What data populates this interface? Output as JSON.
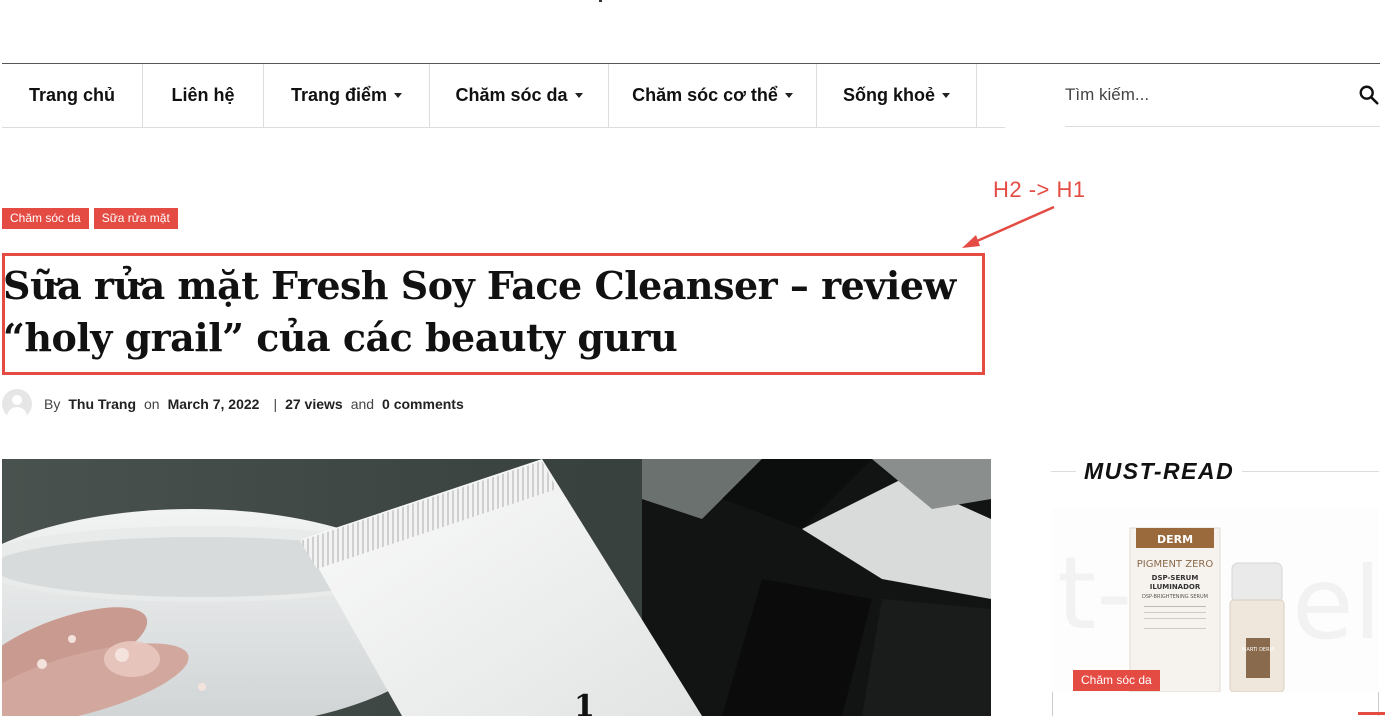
{
  "nav": {
    "items": [
      {
        "label": "Trang chủ",
        "has_dropdown": false
      },
      {
        "label": "Liên hệ",
        "has_dropdown": false
      },
      {
        "label": "Trang điểm",
        "has_dropdown": true
      },
      {
        "label": "Chăm sóc da",
        "has_dropdown": true
      },
      {
        "label": "Chăm sóc cơ thể",
        "has_dropdown": true
      },
      {
        "label": "Sống khoẻ",
        "has_dropdown": true
      }
    ],
    "search_placeholder": "Tìm kiếm..."
  },
  "article": {
    "categories": [
      "Chăm sóc da",
      "Sữa rửa mặt"
    ],
    "title": "Sữa rửa mặt Fresh Soy Face Cleanser – review “holy grail” của các beauty guru",
    "meta": {
      "by": "By",
      "author": "Thu Trang",
      "on": "on",
      "date": "March 7, 2022",
      "separator": "|",
      "views": "27 views",
      "and": "and",
      "comments": "0 comments"
    }
  },
  "annotation": {
    "label": "H2 -> H1",
    "color": "#e44b43"
  },
  "sidebar": {
    "must_read_title": "MUST-READ",
    "card_category": "Chăm sóc da",
    "product_text": {
      "brand": "DERM",
      "name": "PIGMENT ZERO",
      "line1": "DSP-SERUM",
      "line2": "ILUMINADOR",
      "line3": "DSP-BRIGHTENING SERUM",
      "bottle_brand": "MARTI DERM"
    }
  },
  "colors": {
    "accent": "#e44b43",
    "text": "#111111"
  }
}
